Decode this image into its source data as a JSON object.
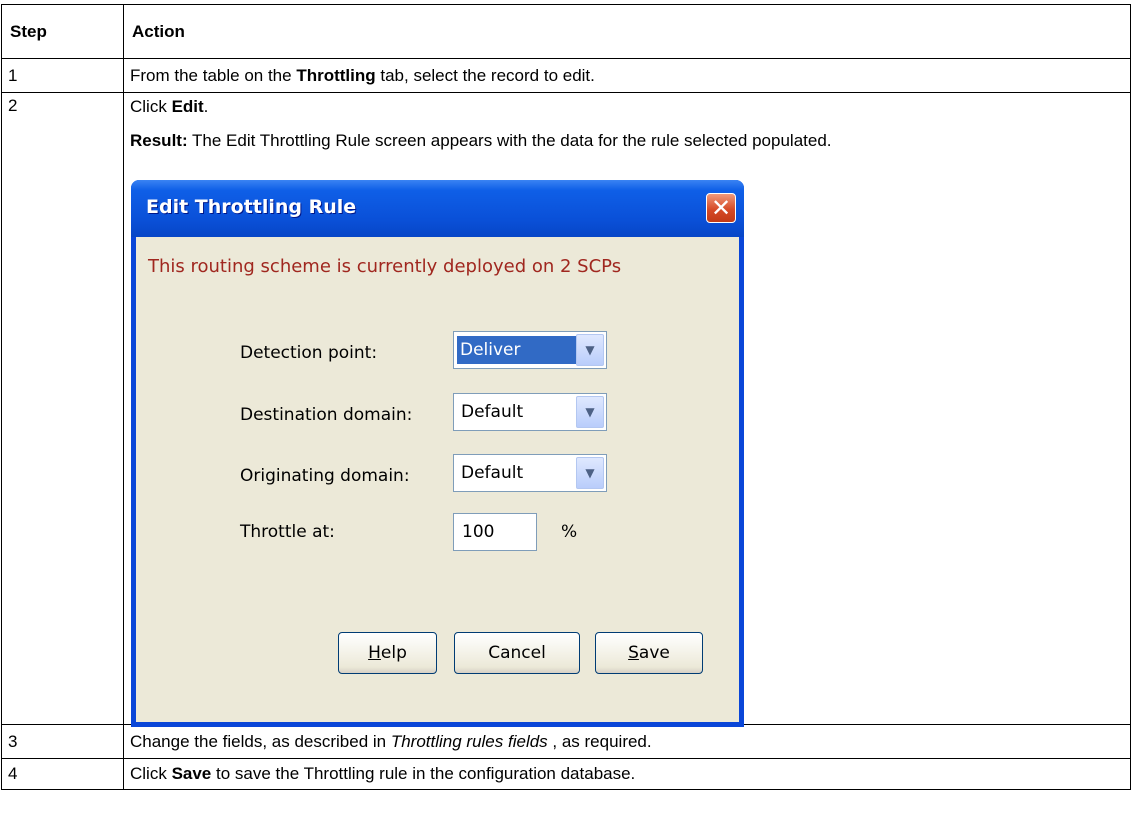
{
  "table": {
    "headers": [
      "Step",
      "Action"
    ],
    "rows": [
      {
        "step": "1",
        "pre": "From the table on the ",
        "bold": "Throttling",
        "post": " tab, select the record to edit."
      },
      {
        "step": "2",
        "pre": "Click ",
        "bold": "Edit",
        "post": ".",
        "result_label": "Result:",
        "result_text": " The Edit Throttling Rule screen appears with the data for the rule selected populated."
      },
      {
        "step": "3",
        "pre": "Change the fields, as described in ",
        "italic": "Throttling rules fields",
        "post": " , as required."
      },
      {
        "step": "4",
        "pre": "Click ",
        "bold": "Save",
        "post": " to save the Throttling rule in the configuration database."
      }
    ]
  },
  "dialog": {
    "title": "Edit Throttling Rule",
    "close_glyph": "✕",
    "warning": "This routing scheme is currently deployed on 2 SCPs",
    "fields": {
      "detection_point": {
        "label": "Detection point:",
        "value": "Deliver"
      },
      "destination_domain": {
        "label": "Destination domain:",
        "value": "Default"
      },
      "originating_domain": {
        "label": "Originating domain:",
        "value": "Default"
      },
      "throttle_at": {
        "label": "Throttle at:",
        "value": "100",
        "unit": "%"
      }
    },
    "buttons": {
      "help": {
        "mnemonic": "H",
        "rest": "elp"
      },
      "cancel": "Cancel",
      "save": {
        "mnemonic": "S",
        "rest": "ave"
      }
    },
    "colors": {
      "title_bar": "#0a50d8",
      "client": "#ece9d8",
      "warning": "#a0271f",
      "selection": "#316ac5"
    }
  }
}
